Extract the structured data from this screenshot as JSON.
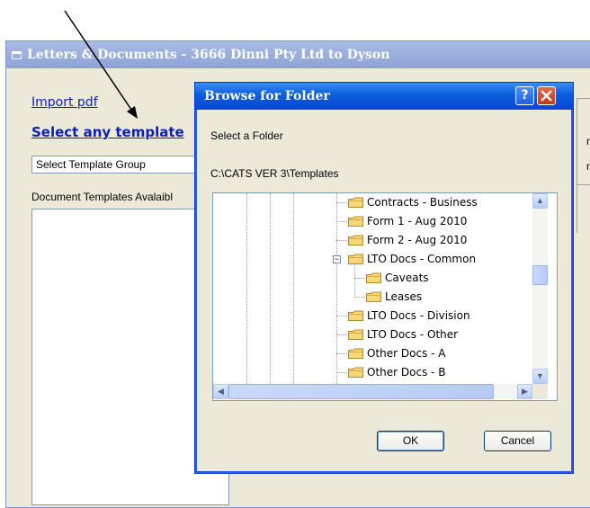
{
  "app": {
    "title": "Letters & Documents - 3666 Dinni Pty Ltd to Dyson",
    "import_link": "Import pdf",
    "template_link": "Select any template",
    "group_select_value": "Select Template Group",
    "templates_label": "Document Templates Avalaibl",
    "right_panel_fragments": [
      "n",
      "n"
    ]
  },
  "dialog": {
    "title": "Browse for Folder",
    "help_label": "?",
    "prompt": "Select a Folder",
    "path": "C:\\CATS VER 3\\Templates",
    "tree": [
      {
        "label": "Contracts - Business",
        "level": 0
      },
      {
        "label": "Form 1 - Aug 2010",
        "level": 0
      },
      {
        "label": "Form 2 - Aug 2010",
        "level": 0
      },
      {
        "label": "LTO Docs - Common",
        "level": 0,
        "expanded": true
      },
      {
        "label": "Caveats",
        "level": 1
      },
      {
        "label": "Leases",
        "level": 1
      },
      {
        "label": "LTO Docs - Division",
        "level": 0
      },
      {
        "label": "LTO Docs - Other",
        "level": 0
      },
      {
        "label": "Other Docs - A",
        "level": 0
      },
      {
        "label": "Other Docs - B",
        "level": 0
      }
    ],
    "ok_label": "OK",
    "cancel_label": "Cancel"
  },
  "icons": {
    "folder": "folder-icon",
    "expander": "collapse-icon",
    "arrow": "annotation-arrow"
  },
  "colors": {
    "dialog_title": "#0a5ddb",
    "link": "#0b1fb5",
    "close": "#c4371a"
  }
}
